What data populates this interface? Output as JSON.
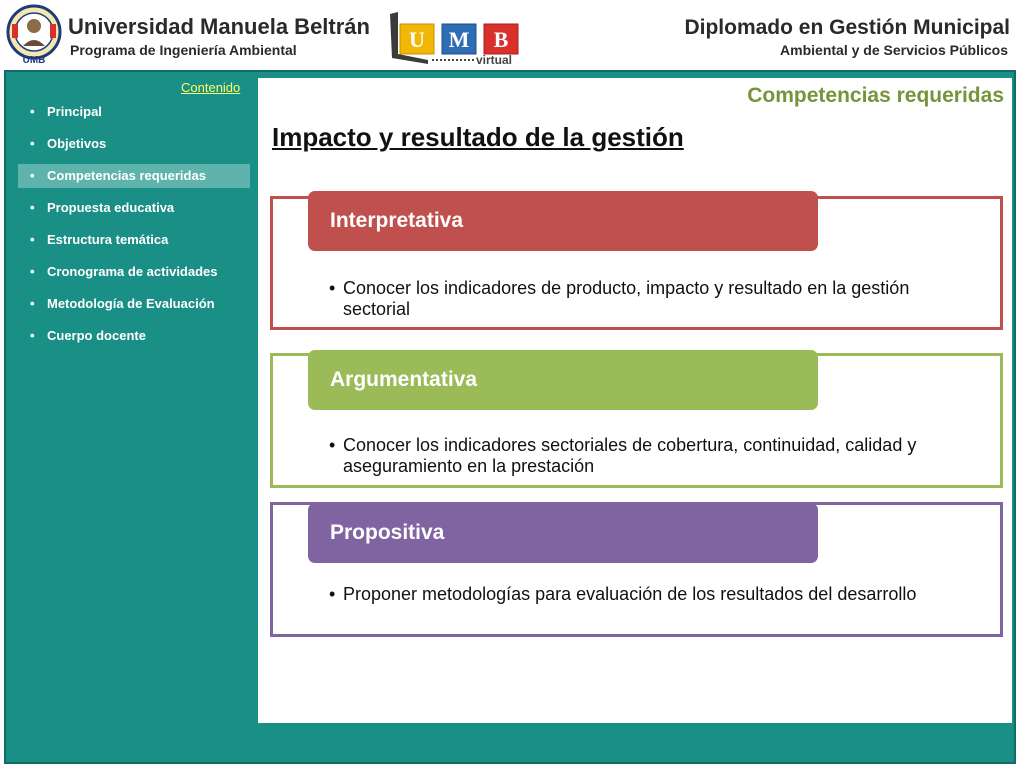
{
  "header": {
    "university": "Universidad Manuela Beltrán",
    "program": "Programa de Ingeniería Ambiental",
    "umb_letters": [
      "U",
      "M",
      "B"
    ],
    "umb_virtual": "virtual",
    "seal_text": "UMB",
    "diploma_title": "Diplomado en Gestión Municipal",
    "diploma_subtitle": "Ambiental y de Servicios Públicos"
  },
  "sidebar": {
    "heading": "Contenido",
    "items": [
      {
        "label": "Principal"
      },
      {
        "label": "Objetivos"
      },
      {
        "label": "Competencias requeridas",
        "active": true
      },
      {
        "label": "Propuesta educativa"
      },
      {
        "label": "Estructura temática"
      },
      {
        "label": "Cronograma de actividades"
      },
      {
        "label": "Metodología de Evaluación"
      },
      {
        "label": "Cuerpo docente"
      }
    ]
  },
  "main": {
    "section_title": "Competencias requeridas",
    "title": "Impacto y resultado de la gestión",
    "competencies": [
      {
        "name": "Interpretativa",
        "color": "#c0504d",
        "bullet": "Conocer los indicadores de producto, impacto y resultado en la gestión sectorial"
      },
      {
        "name": "Argumentativa",
        "color": "#9bbb59",
        "bullet": "Conocer los indicadores sectoriales de cobertura, continuidad, calidad y aseguramiento en la prestación"
      },
      {
        "name": "Propositiva",
        "color": "#8064a2",
        "bullet": "Proponer metodologías para evaluación de los resultados del desarrollo"
      }
    ]
  },
  "colors": {
    "frame": "#1a8f86",
    "link": "#ffff66",
    "section_title": "#77933c"
  }
}
